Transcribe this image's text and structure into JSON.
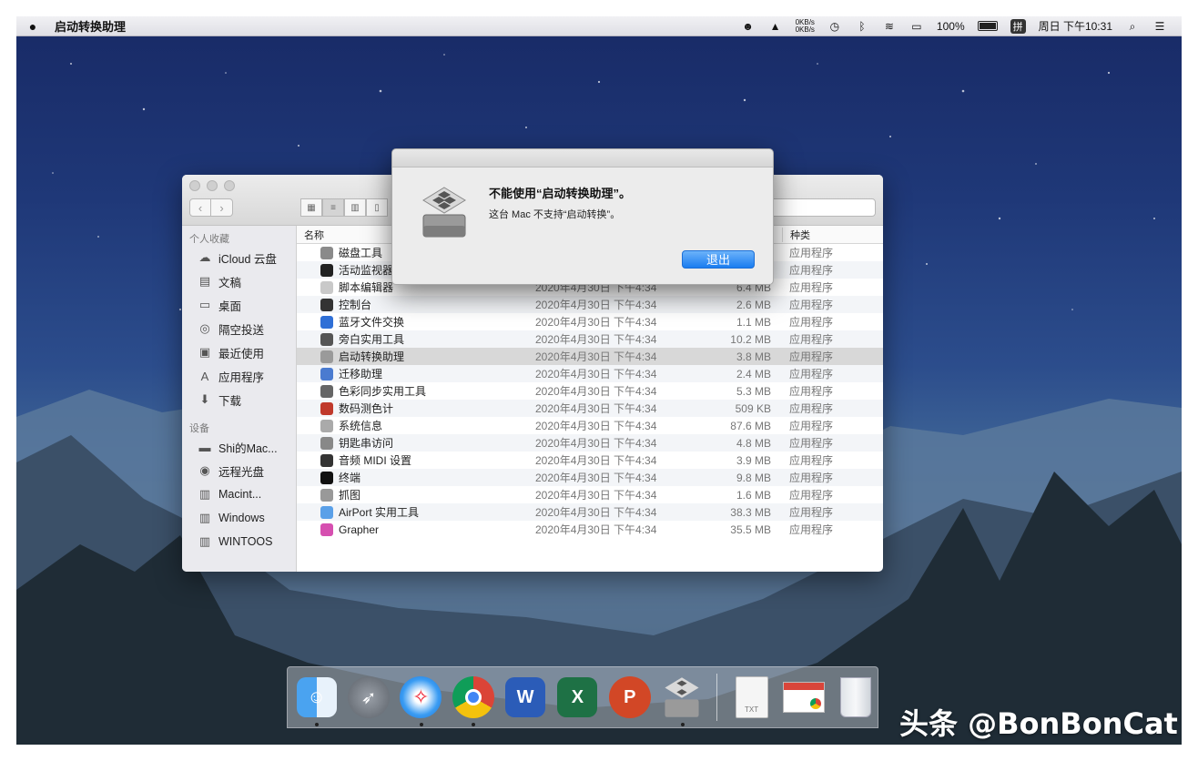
{
  "menubar": {
    "app_name": "启动转换助理",
    "net_up": "0KB/s",
    "net_down": "0KB/s",
    "battery": "100%",
    "input_method": "拼",
    "clock": "周日 下午10:31"
  },
  "finder": {
    "sidebar": {
      "favorites_header": "个人收藏",
      "favorites": [
        {
          "label": "iCloud 云盘",
          "icon": "cloud-icon"
        },
        {
          "label": "文稿",
          "icon": "document-icon"
        },
        {
          "label": "桌面",
          "icon": "desktop-icon"
        },
        {
          "label": "隔空投送",
          "icon": "airdrop-icon"
        },
        {
          "label": "最近使用",
          "icon": "recents-icon"
        },
        {
          "label": "应用程序",
          "icon": "applications-icon"
        },
        {
          "label": "下载",
          "icon": "download-icon"
        }
      ],
      "devices_header": "设备",
      "devices": [
        {
          "label": "Shi的Mac...",
          "icon": "computer-icon"
        },
        {
          "label": "远程光盘",
          "icon": "disc-icon"
        },
        {
          "label": "Macint...",
          "icon": "harddisk-icon"
        },
        {
          "label": "Windows",
          "icon": "harddisk-icon"
        },
        {
          "label": "WINTOOS",
          "icon": "harddisk-icon"
        }
      ]
    },
    "columns": {
      "name": "名称",
      "kind": "种类"
    },
    "files": [
      {
        "name": "磁盘工具",
        "date": "",
        "size": "",
        "kind": "应用程序",
        "color": "#8a8a8a"
      },
      {
        "name": "活动监视器",
        "date": "",
        "size": "",
        "kind": "应用程序",
        "color": "#222222"
      },
      {
        "name": "脚本编辑器",
        "date": "2020年4月30日 下午4:34",
        "size": "6.4 MB",
        "kind": "应用程序",
        "color": "#c9c9c9"
      },
      {
        "name": "控制台",
        "date": "2020年4月30日 下午4:34",
        "size": "2.6 MB",
        "kind": "应用程序",
        "color": "#333333"
      },
      {
        "name": "蓝牙文件交换",
        "date": "2020年4月30日 下午4:34",
        "size": "1.1 MB",
        "kind": "应用程序",
        "color": "#2f6fd6"
      },
      {
        "name": "旁白实用工具",
        "date": "2020年4月30日 下午4:34",
        "size": "10.2 MB",
        "kind": "应用程序",
        "color": "#555555"
      },
      {
        "name": "启动转换助理",
        "date": "2020年4月30日 下午4:34",
        "size": "3.8 MB",
        "kind": "应用程序",
        "color": "#9a9a9a"
      },
      {
        "name": "迁移助理",
        "date": "2020年4月30日 下午4:34",
        "size": "2.4 MB",
        "kind": "应用程序",
        "color": "#4a7bd0"
      },
      {
        "name": "色彩同步实用工具",
        "date": "2020年4月30日 下午4:34",
        "size": "5.3 MB",
        "kind": "应用程序",
        "color": "#666666"
      },
      {
        "name": "数码测色计",
        "date": "2020年4月30日 下午4:34",
        "size": "509 KB",
        "kind": "应用程序",
        "color": "#c0392b"
      },
      {
        "name": "系统信息",
        "date": "2020年4月30日 下午4:34",
        "size": "87.6 MB",
        "kind": "应用程序",
        "color": "#aaaaaa"
      },
      {
        "name": "钥匙串访问",
        "date": "2020年4月30日 下午4:34",
        "size": "4.8 MB",
        "kind": "应用程序",
        "color": "#888888"
      },
      {
        "name": "音频 MIDI 设置",
        "date": "2020年4月30日 下午4:34",
        "size": "3.9 MB",
        "kind": "应用程序",
        "color": "#333333"
      },
      {
        "name": "终端",
        "date": "2020年4月30日 下午4:34",
        "size": "9.8 MB",
        "kind": "应用程序",
        "color": "#111111"
      },
      {
        "name": "抓图",
        "date": "2020年4月30日 下午4:34",
        "size": "1.6 MB",
        "kind": "应用程序",
        "color": "#999999"
      },
      {
        "name": "AirPort 实用工具",
        "date": "2020年4月30日 下午4:34",
        "size": "38.3 MB",
        "kind": "应用程序",
        "color": "#5aa0e8"
      },
      {
        "name": "Grapher",
        "date": "2020年4月30日 下午4:34",
        "size": "35.5 MB",
        "kind": "应用程序",
        "color": "#d64fb0"
      }
    ],
    "selected_index": 6
  },
  "alert": {
    "title": "不能使用“启动转换助理”。",
    "message": "这台 Mac 不支持“启动转换”。",
    "button": "退出"
  },
  "dock": {
    "word_letter": "W",
    "excel_letter": "X",
    "ppt_letter": "P",
    "txt_label": "TXT"
  },
  "watermark": "头条 @BonBonCat"
}
